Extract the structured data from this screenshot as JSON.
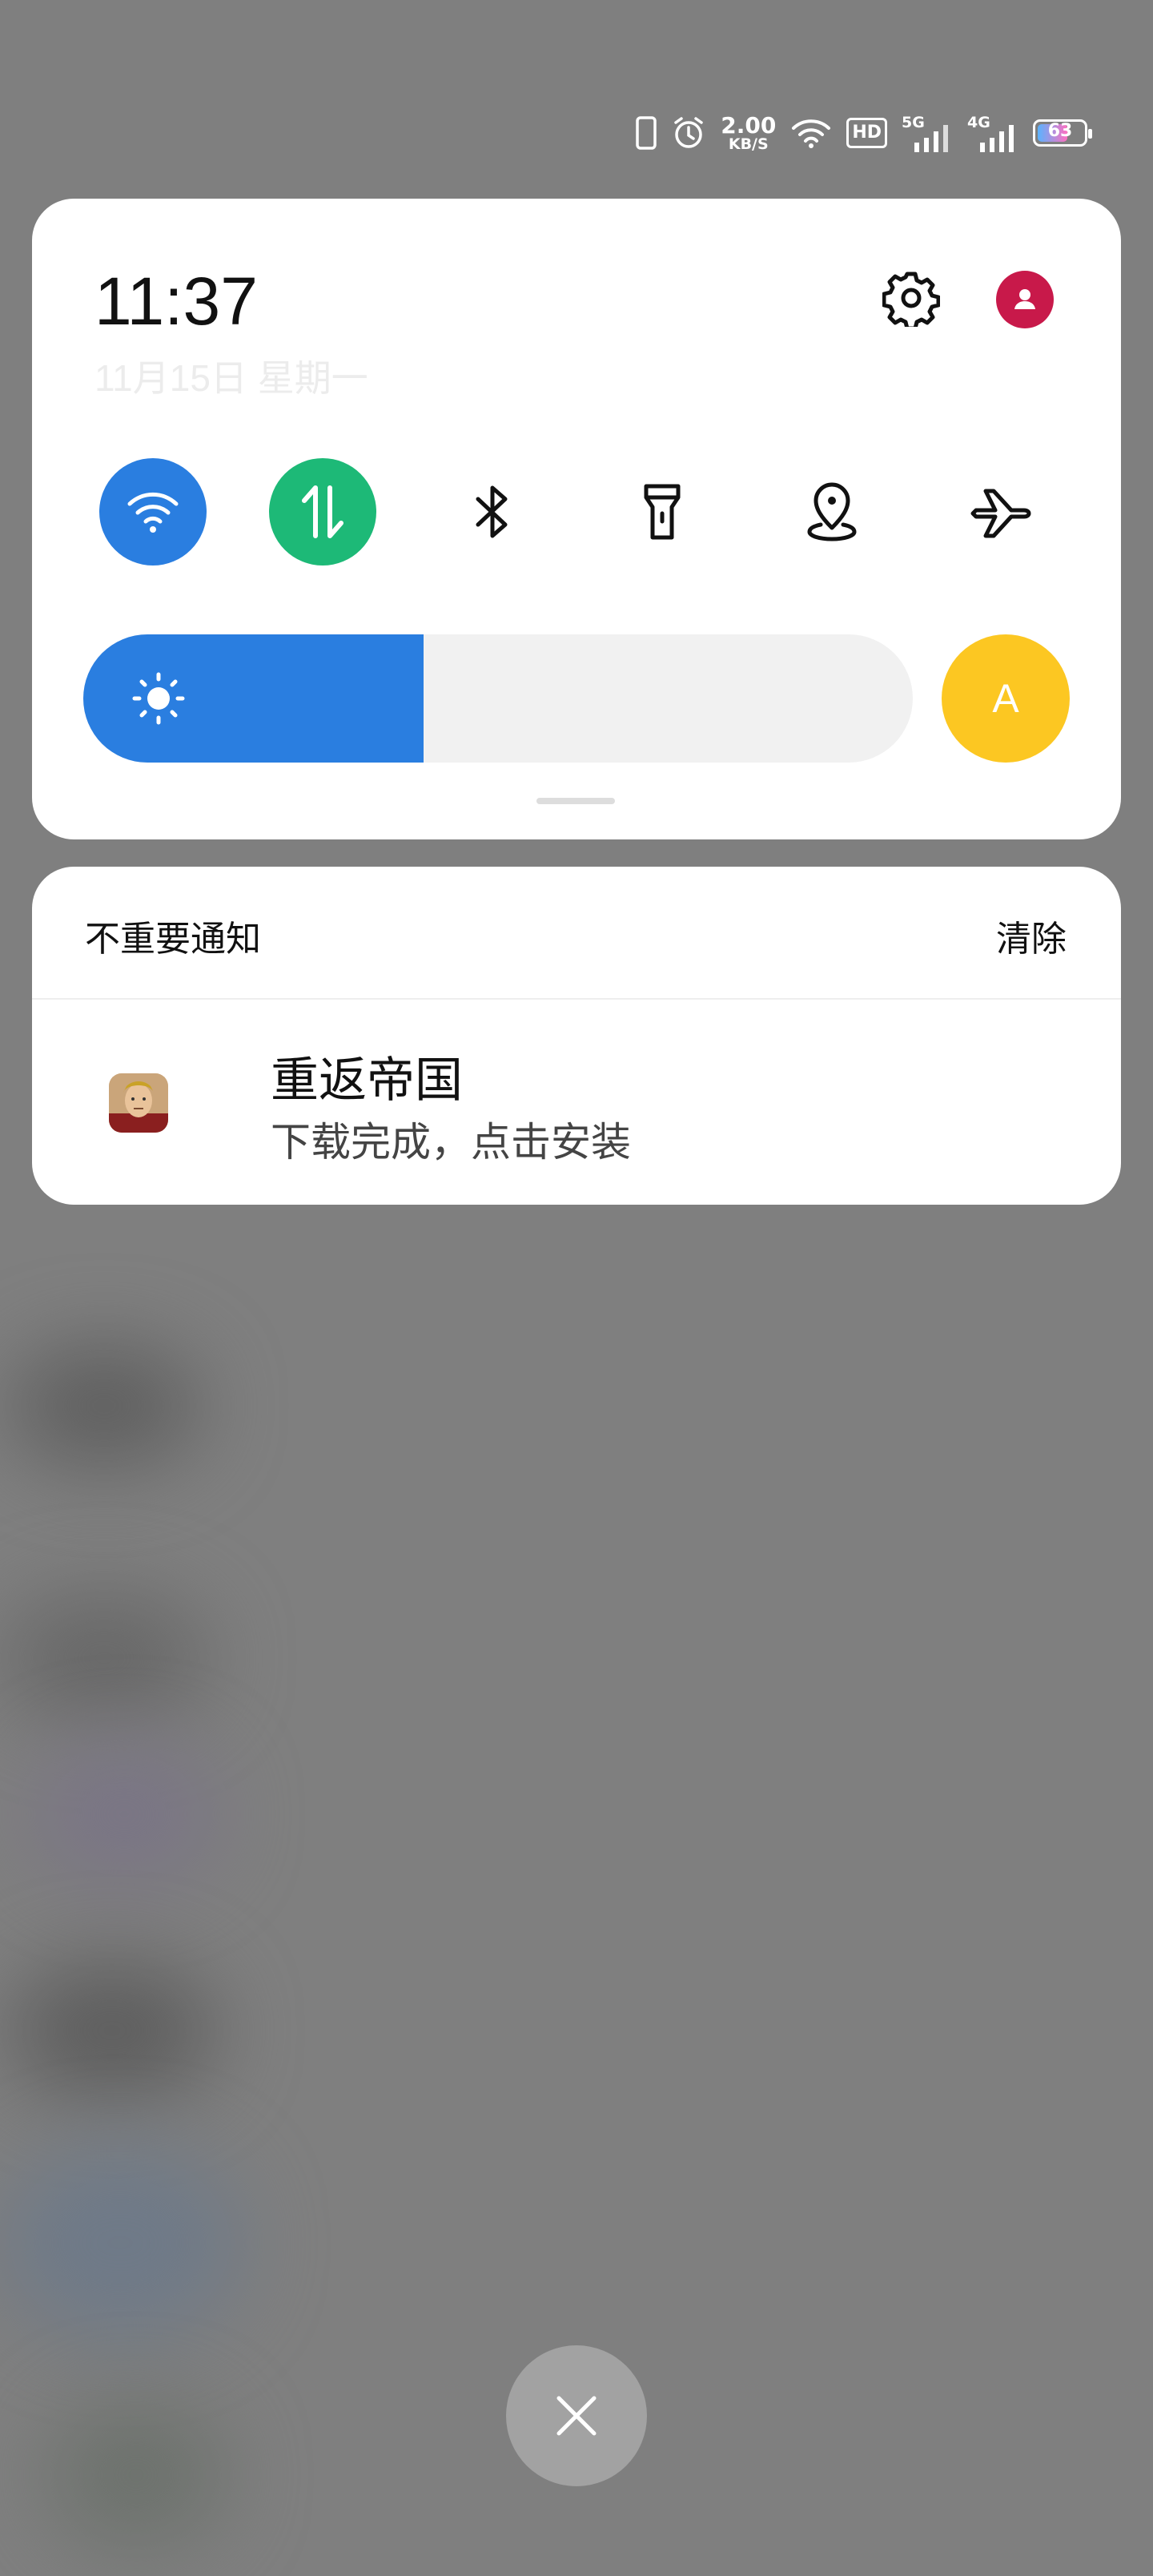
{
  "status_bar": {
    "speed_value": "2.00",
    "speed_unit": "KB/S",
    "hd_label": "HD",
    "sim1_label": "5G",
    "sim2_label": "4G",
    "battery_level": "63",
    "icons": [
      "phone-icon",
      "alarm-icon",
      "wifi-icon",
      "hd-voice-icon",
      "signal-5g-icon",
      "signal-4g-icon",
      "battery-icon"
    ]
  },
  "quick_panel": {
    "time": "11:37",
    "date": "11月15日  星期一",
    "toggles": [
      {
        "name": "wifi",
        "icon": "wifi-icon",
        "active": true,
        "color": "#2a7ee0"
      },
      {
        "name": "mobile-data",
        "icon": "data-arrows-icon",
        "active": true,
        "color": "#1db977"
      },
      {
        "name": "bluetooth",
        "icon": "bluetooth-icon",
        "active": false
      },
      {
        "name": "flashlight",
        "icon": "flashlight-icon",
        "active": false
      },
      {
        "name": "location",
        "icon": "location-icon",
        "active": false
      },
      {
        "name": "airplane",
        "icon": "airplane-icon",
        "active": false
      }
    ],
    "brightness_level": 0.41,
    "auto_brightness_label": "A"
  },
  "notifications": {
    "section_title": "不重要通知",
    "clear_label": "清除",
    "items": [
      {
        "app": "重返帝国",
        "message": "下载完成，点击安装"
      }
    ]
  },
  "colors": {
    "accent_blue": "#2a7ee0",
    "accent_green": "#1db977",
    "avatar_red": "#c8194a",
    "auto_yellow": "#fcc722"
  }
}
